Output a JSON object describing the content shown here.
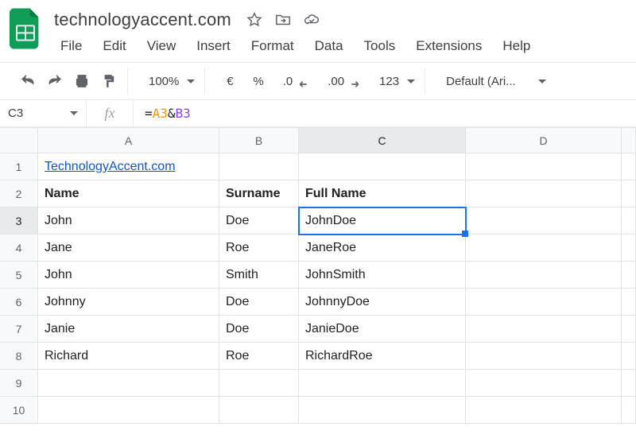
{
  "doc": {
    "title": "technologyaccent.com"
  },
  "menus": [
    "File",
    "Edit",
    "View",
    "Insert",
    "Format",
    "Data",
    "Tools",
    "Extensions",
    "Help"
  ],
  "toolbar": {
    "zoom": "100%",
    "currency": "€",
    "percent": "%",
    "dec_less": ".0",
    "dec_more": ".00",
    "numfmt": "123",
    "font": "Default (Ari..."
  },
  "formula_bar": {
    "cell_ref": "C3",
    "fx_label": "fx",
    "eq": "=",
    "ref1": "A3",
    "amp": "&",
    "ref2": "B3"
  },
  "columns": [
    "A",
    "B",
    "C",
    "D",
    ""
  ],
  "rows": [
    "1",
    "2",
    "3",
    "4",
    "5",
    "6",
    "7",
    "8",
    "9",
    "10"
  ],
  "chart_data": {
    "type": "table",
    "headers": [
      "Name",
      "Surname",
      "Full Name"
    ],
    "link_cell": "TechnologyAccent.com",
    "rows": [
      {
        "name": "John",
        "surname": "Doe",
        "full": "JohnDoe"
      },
      {
        "name": "Jane",
        "surname": "Roe",
        "full": "JaneRoe"
      },
      {
        "name": "John",
        "surname": "Smith",
        "full": "JohnSmith"
      },
      {
        "name": "Johnny",
        "surname": "Doe",
        "full": "JohnnyDoe"
      },
      {
        "name": "Janie",
        "surname": "Doe",
        "full": "JanieDoe"
      },
      {
        "name": "Richard",
        "surname": "Roe",
        "full": "RichardRoe"
      }
    ]
  },
  "selection": {
    "row": 3,
    "col": "C"
  }
}
